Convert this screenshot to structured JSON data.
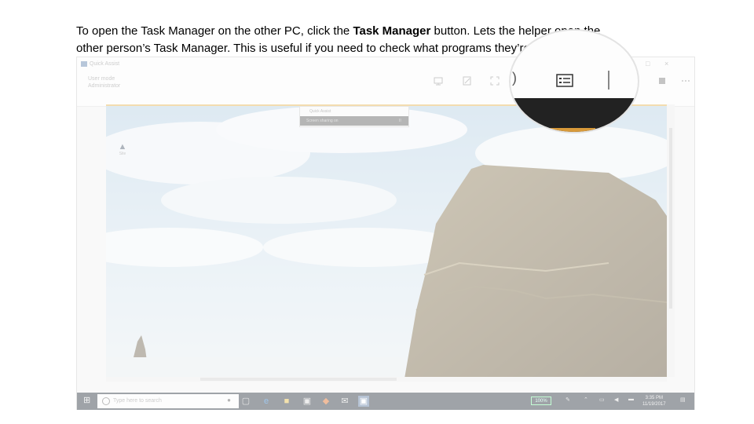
{
  "caption": {
    "line1_a": "To open the Task Manager on the other PC, click the ",
    "line1_b": "Task Manager",
    "line1_c": " button. Lets the helper open the",
    "line2": "other person’s Task Manager. This is useful if you need to check what programs they’re running"
  },
  "window": {
    "title": "Quick Assist",
    "controls": {
      "minimize": "—",
      "maximize": "□",
      "close": "×"
    }
  },
  "toolbar": {
    "mode_line1": "User mode",
    "mode_line2": "Administrator",
    "icons": [
      "select-monitor-icon",
      "annotate-icon",
      "actual-size-icon",
      "task-manager-icon",
      "pause-icon",
      "end-icon",
      "more-icon"
    ]
  },
  "remote": {
    "desktop_icon_label": "Site",
    "mini_window_title": "Quick Assist",
    "mini_window_status": "Screen sharing on",
    "mini_window_pause": "II"
  },
  "taskbar": {
    "search_placeholder": "Type here to search",
    "battery": "100%",
    "time": "3:35 PM",
    "date": "11/19/2017"
  },
  "colors": {
    "accent": "#e7b85e",
    "taskbar": "#3e4650",
    "sky": "#a9c7dd"
  }
}
